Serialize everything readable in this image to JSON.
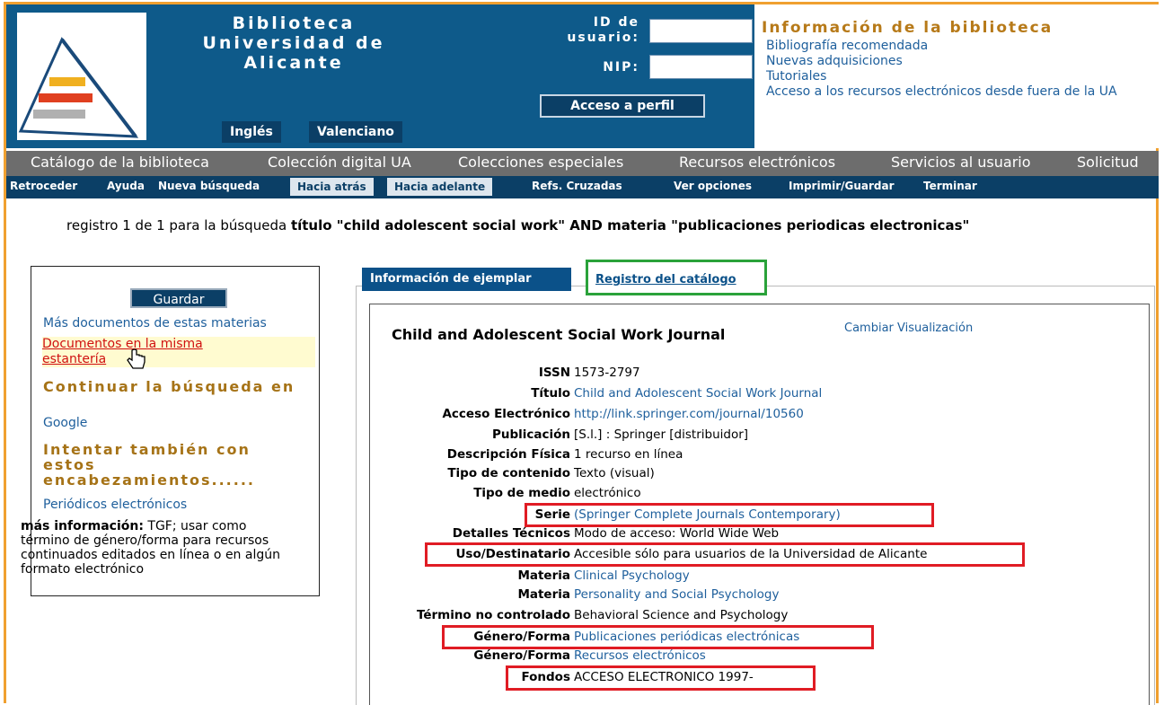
{
  "header": {
    "brand": [
      "Biblioteca",
      "Universidad de",
      "Alicante"
    ],
    "lang_buttons": [
      "Inglés",
      "Valenciano"
    ],
    "user_id_label": [
      "ID de",
      "usuario:"
    ],
    "pin_label": "NIP:",
    "profile_button": "Acceso a perfil"
  },
  "info": {
    "title": "Información de la biblioteca",
    "links": [
      "Bibliografía recomendada",
      "Nuevas adquisiciones",
      "Tutoriales",
      "Acceso a los recursos electrónicos desde fuera de la UA"
    ]
  },
  "nav_main": [
    "Catálogo de la biblioteca",
    "Colección digital UA",
    "Colecciones especiales",
    "Recursos electrónicos",
    "Servicios al usuario",
    "Solicitud"
  ],
  "nav_tools": [
    "Retroceder",
    "Ayuda",
    "Nueva búsqueda",
    "Hacia atrás",
    "Hacia adelante",
    "Refs. Cruzadas",
    "Ver opciones",
    "Imprimir/Guardar",
    "Terminar"
  ],
  "query": {
    "prefix": "registro 1 de 1 para la búsqueda ",
    "terms": "título \"child adolescent social work\" AND materia \"publicaciones periodicas electronicas\""
  },
  "left": {
    "save": "Guardar",
    "more_docs": "Más documentos de estas materias",
    "shelf_docs": "Documentos en la misma estantería",
    "continue_head": "Continuar la búsqueda en",
    "google": "Google",
    "try_head": "Intentar también con estos encabezamientos......",
    "periodicos": "Periódicos electrónicos",
    "more_info_label": "más información:",
    "more_info_text": " TGF; usar como término de género/forma para recursos continuados editados en línea o en algún formato electrónico"
  },
  "tabs": [
    "Información de ejemplar",
    "Registro del catálogo"
  ],
  "record": {
    "title": "Child and Adolescent Social Work Journal",
    "change_view": "Cambiar Visualización",
    "fields": [
      {
        "label": "ISSN",
        "value": "1573-2797",
        "link": false
      },
      {
        "label": "Título",
        "value": "Child and Adolescent Social Work Journal",
        "link": true
      },
      {
        "label": "Acceso Electrónico",
        "value": "http://link.springer.com/journal/10560",
        "link": true
      },
      {
        "label": "Publicación",
        "value": "[S.l.] : Springer [distribuidor]",
        "link": false
      },
      {
        "label": "Descripción Física",
        "value": "1 recurso en línea",
        "link": false
      },
      {
        "label": "Tipo de contenido",
        "value": "Texto (visual)",
        "link": false
      },
      {
        "label": "Tipo de medio",
        "value": "electrónico",
        "link": false
      },
      {
        "label": "Serie",
        "value": "(Springer Complete Journals Contemporary)",
        "link": true
      },
      {
        "label": "Detalles Técnicos",
        "value": "Modo de acceso: World Wide Web",
        "link": false
      },
      {
        "label": "Uso/Destinatario",
        "value": "Accesible sólo para usuarios de la Universidad de Alicante",
        "link": false
      },
      {
        "label": "Materia",
        "value": "Clinical Psychology",
        "link": true
      },
      {
        "label": "Materia",
        "value": "Personality and Social Psychology",
        "link": true
      },
      {
        "label": "Término no controlado",
        "value": "Behavioral Science and Psychology",
        "link": false
      },
      {
        "label": "Género/Forma",
        "value": "Publicaciones periódicas electrónicas",
        "link": true
      },
      {
        "label": "Género/Forma",
        "value": "Recursos electrónicos",
        "link": true
      },
      {
        "label": "Fondos",
        "value": "ACCESO ELECTRONICO 1997-",
        "link": false
      }
    ]
  },
  "colors": {
    "header_blue": "#0e5a8a",
    "nav_gray": "#6d6d6d",
    "nav_dark": "#0b3f66",
    "highlight_red": "#e01c24",
    "tab_green": "#2aa23a",
    "link_blue": "#1e5f9c"
  }
}
